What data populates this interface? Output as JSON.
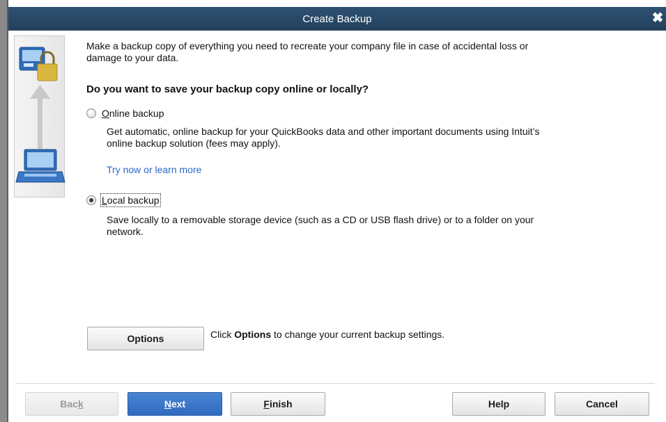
{
  "window": {
    "title": "Create Backup",
    "close_glyph": "✖"
  },
  "intro": {
    "text": "Make a backup copy of everything you need to recreate your company file in case of accidental loss or damage to your data."
  },
  "question": "Do you want to save your backup copy online or locally?",
  "online": {
    "label_mnemonic": "O",
    "label_rest": "nline backup",
    "selected": false,
    "description": "Get automatic, online backup for your QuickBooks data and other important documents using Intuit’s online backup solution (fees may apply).",
    "link": "Try now or learn more"
  },
  "local": {
    "label_mnemonic": "L",
    "label_rest": "ocal backup",
    "selected": true,
    "description": "Save locally to a removable storage device (such as a CD or USB flash drive) or to a folder on your network."
  },
  "options": {
    "button_label": "Options",
    "hint_prefix": "Click ",
    "hint_bold": "Options",
    "hint_suffix": " to change your current backup settings."
  },
  "footer": {
    "back_pre": "Bac",
    "back_mnemonic": "k",
    "next_mnemonic": "N",
    "next_rest": "ext",
    "finish_mnemonic": "F",
    "finish_rest": "inish",
    "help": "Help",
    "cancel": "Cancel"
  },
  "icons": {
    "side": [
      "computer-lock-icon",
      "arrow-up-icon",
      "laptop-icon"
    ]
  },
  "colors": {
    "titlebar": "#2a4868",
    "link": "#2c68c7",
    "primary_button": "#3a74c8"
  }
}
